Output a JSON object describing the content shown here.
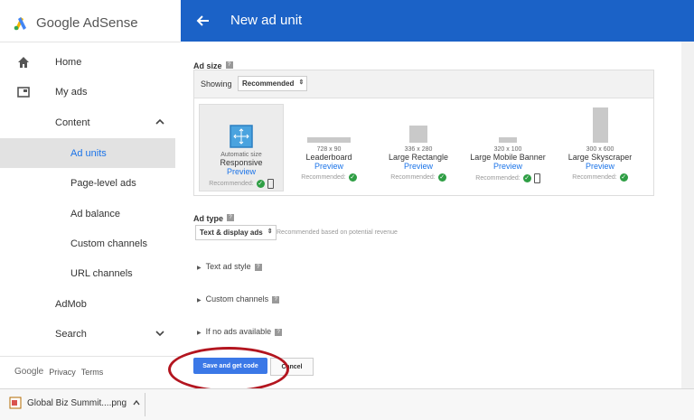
{
  "brand": {
    "name": "Google AdSense"
  },
  "sidebar": {
    "items": [
      {
        "label": "Home",
        "icon": "home-icon"
      },
      {
        "label": "My ads",
        "icon": "my-ads-icon"
      },
      {
        "label": "Content"
      },
      {
        "label": "Ad units"
      },
      {
        "label": "Page-level ads"
      },
      {
        "label": "Ad balance"
      },
      {
        "label": "Custom channels"
      },
      {
        "label": "URL channels"
      },
      {
        "label": "AdMob"
      },
      {
        "label": "Search"
      }
    ],
    "footer": {
      "google": "Google",
      "privacy": "Privacy",
      "terms": "Terms"
    }
  },
  "header": {
    "title": "New ad unit"
  },
  "ad_size": {
    "label": "Ad size",
    "showing_label": "Showing",
    "filter_value": "Recommended",
    "cards": [
      {
        "dims": "Automatic size",
        "name": "Responsive",
        "preview": "Preview",
        "recommended": "Recommended:"
      },
      {
        "dims": "728 x 90",
        "name": "Leaderboard",
        "preview": "Preview",
        "recommended": "Recommended:"
      },
      {
        "dims": "336 x 280",
        "name": "Large Rectangle",
        "preview": "Preview",
        "recommended": "Recommended:"
      },
      {
        "dims": "320 x 100",
        "name": "Large Mobile Banner",
        "preview": "Preview",
        "recommended": "Recommended:"
      },
      {
        "dims": "300 x 600",
        "name": "Large Skyscraper",
        "preview": "Preview",
        "recommended": "Recommended:"
      }
    ]
  },
  "ad_type": {
    "label": "Ad type",
    "value": "Text & display ads",
    "hint": "Recommended based on potential revenue"
  },
  "options": {
    "text_ad_style": "Text ad style",
    "custom_channels": "Custom channels",
    "if_no_ads": "If no ads available"
  },
  "actions": {
    "save": "Save and get code",
    "cancel": "Cancel"
  },
  "download": {
    "filename": "Global Biz Summit....png"
  },
  "colors": {
    "header": "#1b62c7",
    "accent": "#1a73e8",
    "primary_button": "#3b78e7",
    "annotation": "#b3151f"
  }
}
